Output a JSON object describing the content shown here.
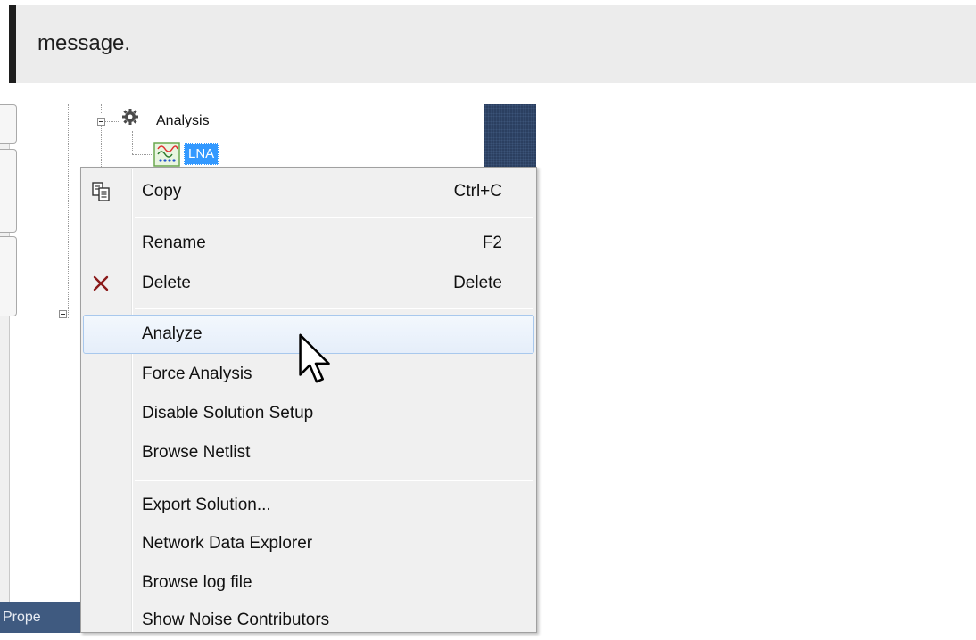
{
  "banner": {
    "text": "message."
  },
  "tree": {
    "analysis_label": "Analysis",
    "lna_label": "LNA"
  },
  "properties_tab": "Prope",
  "menu": {
    "copy": {
      "label": "Copy",
      "shortcut": "Ctrl+C",
      "icon": "copy-icon"
    },
    "rename": {
      "label": "Rename",
      "shortcut": "F2"
    },
    "delete": {
      "label": "Delete",
      "shortcut": "Delete",
      "icon": "delete-x-icon"
    },
    "analyze": {
      "label": "Analyze"
    },
    "force_analysis": {
      "label": "Force Analysis"
    },
    "disable_solution_setup": {
      "label": "Disable Solution Setup"
    },
    "browse_netlist": {
      "label": "Browse Netlist"
    },
    "export_solution": {
      "label": "Export Solution..."
    },
    "network_data_explorer": {
      "label": "Network Data Explorer"
    },
    "browse_log_file": {
      "label": "Browse log file"
    },
    "show_noise_contributors": {
      "label": "Show Noise Contributors"
    }
  },
  "colors": {
    "selection": "#3399ff",
    "menu_bg": "#f0f0f0",
    "highlight_border": "#a8c8ed",
    "delete_icon": "#8b1a1a",
    "panel_dark": "#2b3f60"
  }
}
